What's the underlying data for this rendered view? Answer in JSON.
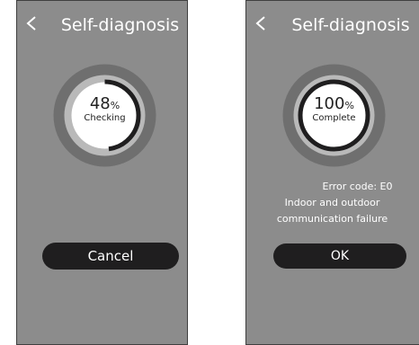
{
  "left": {
    "title": "Self-diagnosis",
    "progress_value": "48",
    "progress_unit": "%",
    "progress_fraction": 0.48,
    "status": "Checking",
    "cancel_label": "Cancel"
  },
  "right": {
    "title": "Self-diagnosis",
    "progress_value": "100",
    "progress_unit": "%",
    "progress_fraction": 1.0,
    "status": "Complete",
    "error_code_line": "Error code: E0",
    "error_desc_line1": "Indoor and outdoor",
    "error_desc_line2": "communication failure",
    "ok_label": "OK"
  },
  "colors": {
    "screen_bg": "#8c8c8c",
    "ring_outer": "#6f6f6f",
    "ring_inner": "#b9b9b9",
    "center": "#ffffff",
    "progress_arc": "#1f1e1f",
    "button_bg": "#1f1e1f"
  },
  "icons": {
    "back": "chevron-left-icon"
  }
}
